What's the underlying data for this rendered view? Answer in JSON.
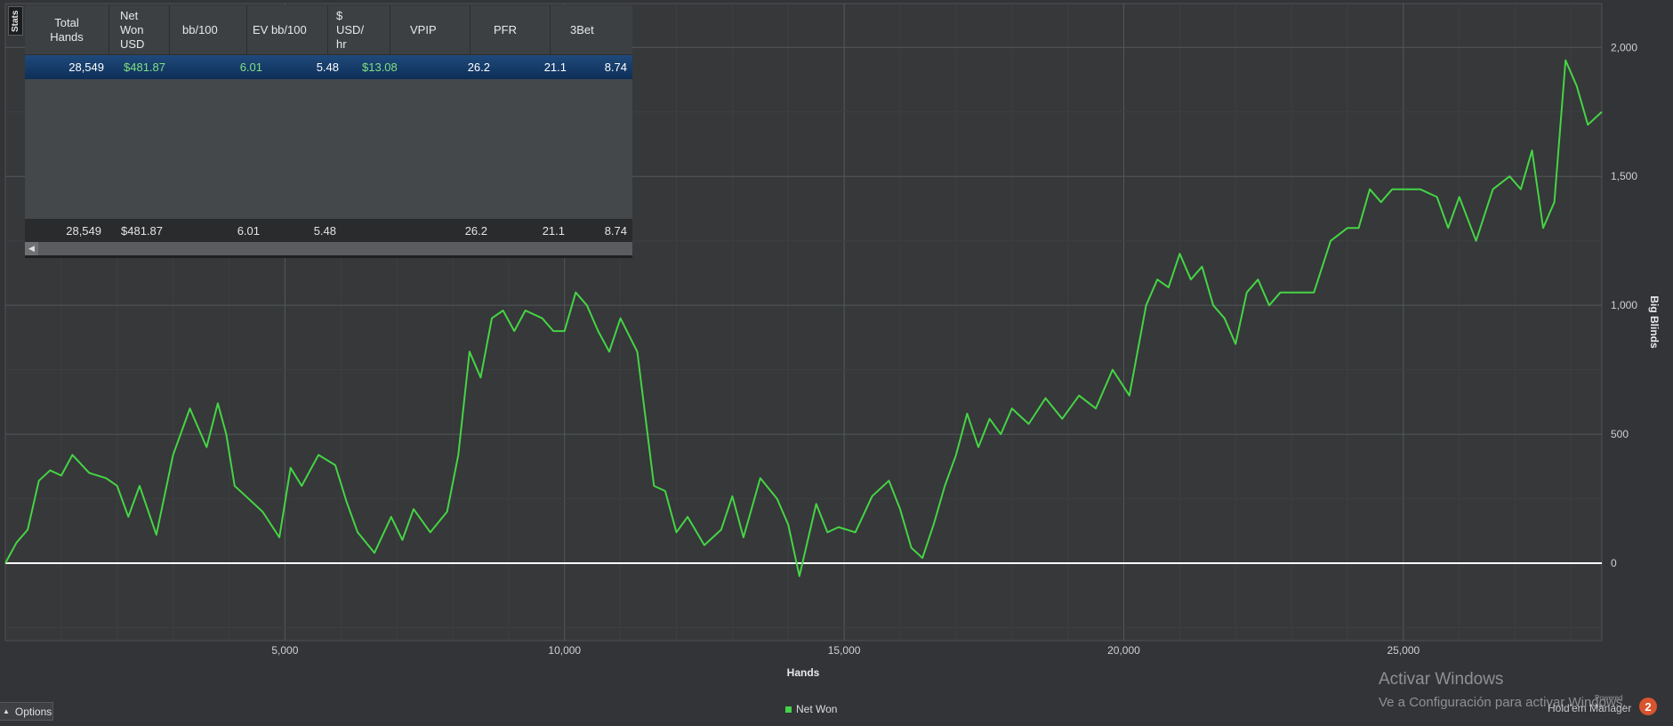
{
  "stats_tab": {
    "label": "Stats"
  },
  "stats_table": {
    "columns": [
      "Total\nHands",
      "Net\nWon\nUSD",
      "bb/100",
      "EV bb/100",
      "$\nUSD/\nhr",
      "VPIP",
      "PFR",
      "3Bet"
    ],
    "selected_row": [
      "28,549",
      "$481.87",
      "6.01",
      "5.48",
      "$13.08",
      "26.2",
      "21.1",
      "8.74"
    ],
    "totals_row": [
      "28,549",
      "$481.87",
      "6.01",
      "5.48",
      "",
      "26.2",
      "21.1",
      "8.74"
    ]
  },
  "chart_data": {
    "type": "line",
    "xlabel": "Hands",
    "ylabel": "Big Blinds",
    "xlim": [
      0,
      28549
    ],
    "ylim": [
      -300,
      2170
    ],
    "x_ticks": [
      5000,
      10000,
      15000,
      20000,
      25000
    ],
    "x_tick_labels": [
      "5,000",
      "10,000",
      "15,000",
      "20,000",
      "25,000"
    ],
    "y_ticks": [
      0,
      500,
      1000,
      1500,
      2000
    ],
    "y_tick_labels": [
      "0",
      "500",
      "1,000",
      "1,500",
      "2,000"
    ],
    "grid": true,
    "legend_position": "bottom-center",
    "series": [
      {
        "name": "Net Won",
        "color": "#45d445",
        "x": [
          0,
          200,
          400,
          600,
          800,
          1000,
          1200,
          1500,
          1800,
          2000,
          2200,
          2400,
          2700,
          3000,
          3300,
          3600,
          3800,
          3950,
          4100,
          4300,
          4600,
          4900,
          5100,
          5300,
          5600,
          5900,
          6100,
          6300,
          6600,
          6900,
          7100,
          7300,
          7600,
          7900,
          8100,
          8300,
          8500,
          8700,
          8900,
          9100,
          9300,
          9600,
          9800,
          10000,
          10200,
          10400,
          10600,
          10800,
          11000,
          11300,
          11600,
          11800,
          12000,
          12200,
          12500,
          12800,
          13000,
          13200,
          13500,
          13800,
          14000,
          14200,
          14500,
          14700,
          14900,
          15200,
          15500,
          15800,
          16000,
          16200,
          16400,
          16600,
          16800,
          17000,
          17200,
          17400,
          17600,
          17800,
          18000,
          18300,
          18600,
          18900,
          19200,
          19500,
          19800,
          20100,
          20400,
          20600,
          20800,
          21000,
          21200,
          21400,
          21600,
          21800,
          22000,
          22200,
          22400,
          22600,
          22800,
          23100,
          23400,
          23700,
          24000,
          24200,
          24400,
          24600,
          24800,
          25000,
          25300,
          25600,
          25800,
          26000,
          26300,
          26600,
          26900,
          27100,
          27300,
          27500,
          27700,
          27900,
          28100,
          28300,
          28549
        ],
        "y": [
          0,
          80,
          130,
          320,
          360,
          340,
          420,
          350,
          330,
          300,
          180,
          300,
          110,
          420,
          600,
          450,
          620,
          500,
          300,
          260,
          200,
          100,
          370,
          300,
          420,
          380,
          240,
          120,
          40,
          180,
          90,
          210,
          120,
          200,
          420,
          820,
          720,
          950,
          980,
          900,
          980,
          950,
          900,
          900,
          1050,
          1000,
          900,
          820,
          950,
          820,
          300,
          280,
          120,
          180,
          70,
          130,
          260,
          100,
          330,
          250,
          150,
          -50,
          230,
          120,
          140,
          120,
          260,
          320,
          210,
          60,
          20,
          150,
          300,
          420,
          580,
          450,
          560,
          500,
          600,
          540,
          640,
          560,
          650,
          600,
          750,
          650,
          1000,
          1100,
          1070,
          1200,
          1100,
          1150,
          1000,
          950,
          850,
          1050,
          1100,
          1000,
          1050,
          1050,
          1050,
          1250,
          1300,
          1300,
          1450,
          1400,
          1450,
          1450,
          1450,
          1420,
          1300,
          1420,
          1250,
          1450,
          1500,
          1450,
          1600,
          1300,
          1400,
          1950,
          1850,
          1700,
          1750
        ]
      }
    ],
    "zero_line": true
  },
  "options_button": {
    "label": "Options"
  },
  "watermark": {
    "line1": "Activar Windows",
    "line2": "Ve a Configuración para activar Windows."
  },
  "branding": {
    "powered_by": "Powered by",
    "name": "Hold'em Manager",
    "icon_text": "2"
  }
}
